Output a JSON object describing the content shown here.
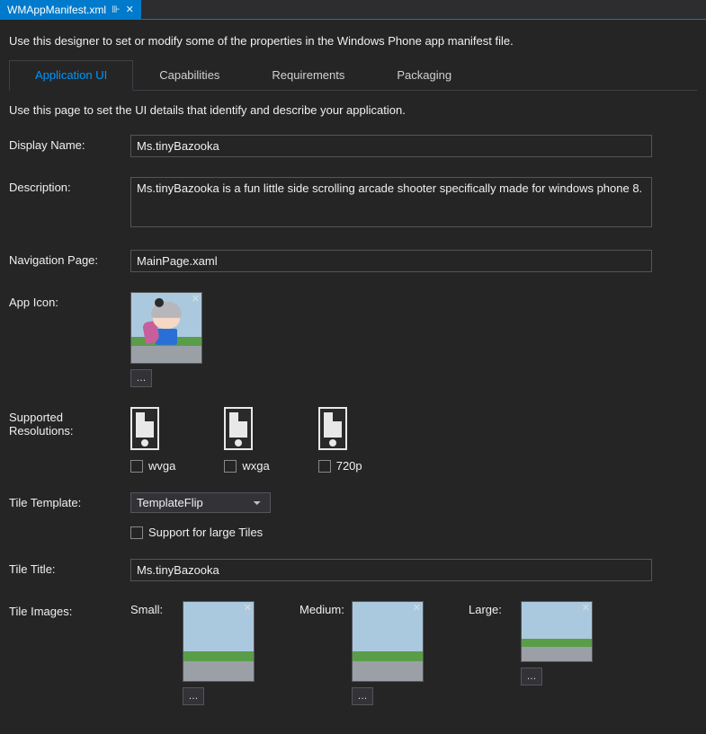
{
  "docTab": {
    "title": "WMAppManifest.xml",
    "pinGlyph": "⊪",
    "closeGlyph": "✕"
  },
  "intro": "Use this designer to set or modify some of the properties in the Windows Phone app manifest file.",
  "tabs": {
    "app_ui": "Application UI",
    "capabilities": "Capabilities",
    "requirements": "Requirements",
    "packaging": "Packaging"
  },
  "subintro": "Use this page to set the UI details that identify and describe your application.",
  "labels": {
    "display_name": "Display Name:",
    "description": "Description:",
    "navigation_page": "Navigation Page:",
    "app_icon": "App Icon:",
    "supported_res": "Supported Resolutions:",
    "tile_template": "Tile Template:",
    "tile_title": "Tile Title:",
    "tile_images": "Tile Images:",
    "support_large": "Support for large Tiles"
  },
  "values": {
    "display_name": "Ms.tinyBazooka",
    "description": "Ms.tinyBazooka is a fun little side scrolling arcade shooter specifically made for windows phone 8.",
    "navigation_page": "MainPage.xaml",
    "tile_template": "TemplateFlip",
    "tile_title": "Ms.tinyBazooka"
  },
  "resolutions": {
    "wvga": "wvga",
    "wxga": "wxga",
    "p720": "720p"
  },
  "tile_sizes": {
    "small": "Small:",
    "medium": "Medium:",
    "large": "Large:"
  },
  "browse": "…"
}
